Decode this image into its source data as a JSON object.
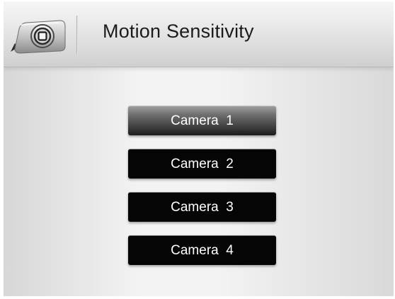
{
  "header": {
    "icon": "camera-icon",
    "title": "Motion Sensitivity"
  },
  "cameras": [
    {
      "label": "Camera  1",
      "selected": true
    },
    {
      "label": "Camera  2",
      "selected": false
    },
    {
      "label": "Camera  3",
      "selected": false
    },
    {
      "label": "Camera  4",
      "selected": false
    }
  ],
  "colors": {
    "button_fill": "#050505",
    "selected_button": "#6e6e6e",
    "button_text": "#ffffff",
    "title_text": "#1b1b1b"
  }
}
